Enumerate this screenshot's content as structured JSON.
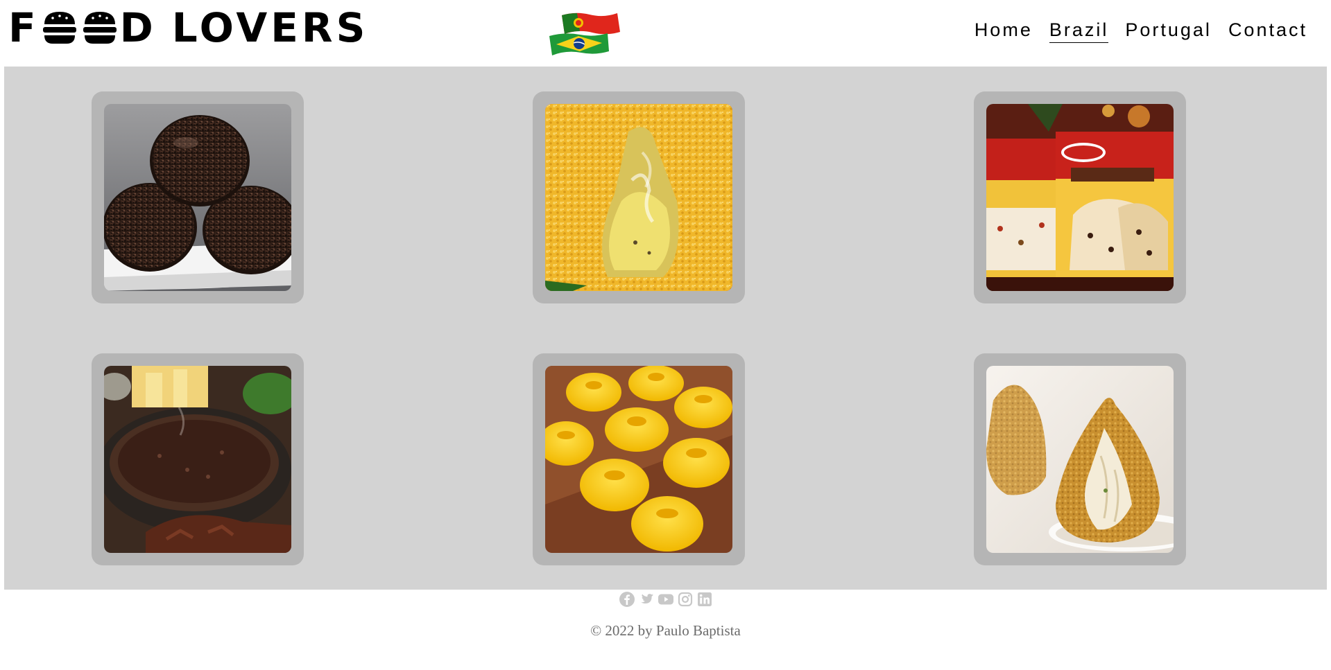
{
  "header": {
    "logo": {
      "letter_f": "F",
      "letter_d": "D",
      "word": "LOVERS"
    },
    "flags": [
      "portugal-flag-icon",
      "brazil-flag-icon"
    ],
    "nav": [
      {
        "label": "Home"
      },
      {
        "label": "Brazil",
        "active": true
      },
      {
        "label": "Portugal"
      },
      {
        "label": "Contact"
      }
    ]
  },
  "gallery": {
    "background": "#d3d3d3",
    "card_frame": "#b5b5b5",
    "items": [
      {
        "icon": "brigadeiro-photo"
      },
      {
        "icon": "pastel-photo"
      },
      {
        "icon": "panettone-photo"
      },
      {
        "icon": "feijoada-photo"
      },
      {
        "icon": "quindim-photo"
      },
      {
        "icon": "coxinha-photo"
      }
    ]
  },
  "footer": {
    "social": [
      "facebook-icon",
      "twitter-icon",
      "youtube-icon",
      "instagram-icon",
      "linkedin-icon"
    ],
    "icon_color": "#c8c8c8",
    "copyright": "© 2022 by Paulo Baptista"
  }
}
